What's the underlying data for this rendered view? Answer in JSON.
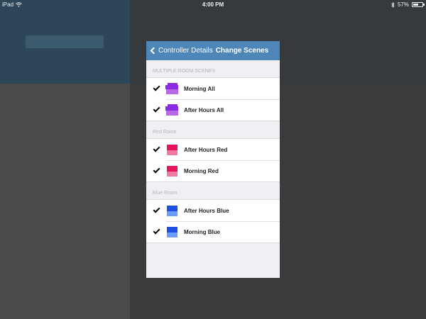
{
  "status_bar": {
    "device": "iPad",
    "time": "4:00 PM",
    "battery": "57%",
    "battery_level": 0.57
  },
  "colors": {
    "nav": "#4f86b8",
    "purple": "#8a2be2",
    "purple_light": "#b56be8",
    "red": "#e8145a",
    "red_light": "#f07aa6",
    "blue": "#1e4fe0",
    "blue_light": "#6b9dff"
  },
  "nav": {
    "back_label": "Controller Details",
    "title": "Change Scenes"
  },
  "sections": [
    {
      "header": "MULTIPLE ROOM SCENES",
      "items": [
        {
          "label": "Morning All",
          "checked": true,
          "icon": "multi-room-scene-icon",
          "color": "purple"
        },
        {
          "label": "After Hours All",
          "checked": true,
          "icon": "multi-room-scene-icon",
          "color": "purple"
        }
      ]
    },
    {
      "header": "Red Room",
      "items": [
        {
          "label": "After Hours Red",
          "checked": true,
          "icon": "room-scene-icon",
          "color": "red"
        },
        {
          "label": "Morning Red",
          "checked": true,
          "icon": "room-scene-icon",
          "color": "red"
        }
      ]
    },
    {
      "header": "Blue Room",
      "items": [
        {
          "label": "After Hours Blue",
          "checked": true,
          "icon": "room-scene-icon",
          "color": "blue"
        },
        {
          "label": "Morning Blue",
          "checked": true,
          "icon": "room-scene-icon",
          "color": "blue"
        }
      ]
    }
  ]
}
